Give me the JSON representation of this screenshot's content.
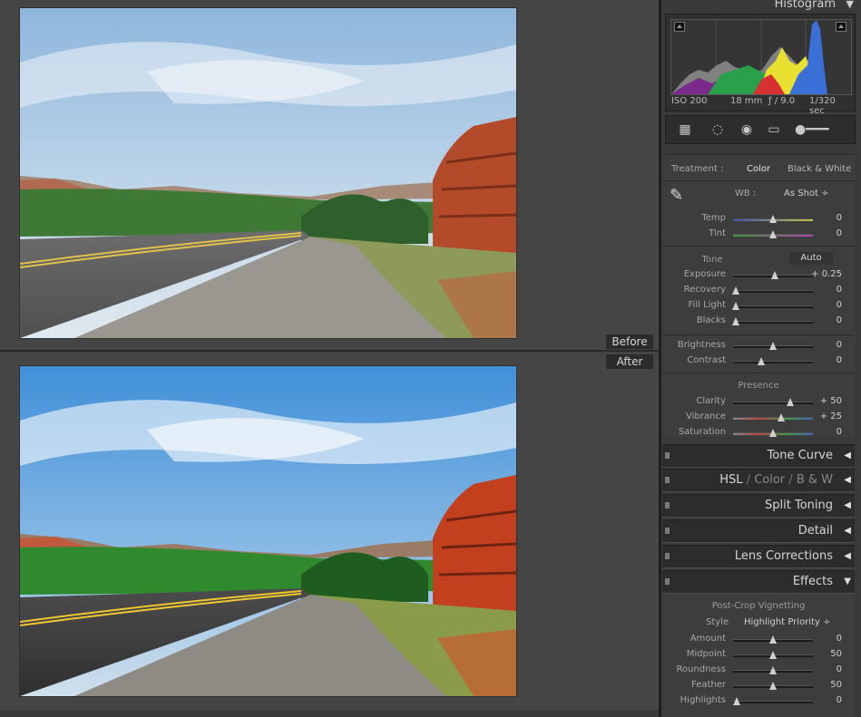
{
  "compare": {
    "before_label": "Before",
    "after_label": "After"
  },
  "histogram": {
    "title": "Histogram",
    "iso": "ISO 200",
    "focal": "18 mm",
    "aperture": "ƒ / 9.0",
    "shutter": "1/320 sec"
  },
  "basic": {
    "treatment_label": "Treatment :",
    "treatment_color": "Color",
    "treatment_bw": "Black & White",
    "wb_label": "WB :",
    "wb_value": "As Shot ÷",
    "tone_label": "Tone",
    "auto_label": "Auto",
    "presence_label": "Presence",
    "sliders": [
      {
        "label": "Temp",
        "value": "0",
        "pos": 0.5
      },
      {
        "label": "Tint",
        "value": "0",
        "pos": 0.5
      },
      {
        "label": "Exposure",
        "value": "+ 0.25",
        "pos": 0.52
      },
      {
        "label": "Recovery",
        "value": "0",
        "pos": 0.03
      },
      {
        "label": "Fill Light",
        "value": "0",
        "pos": 0.03
      },
      {
        "label": "Blacks",
        "value": "0",
        "pos": 0.03
      },
      {
        "label": "Brightness",
        "value": "0",
        "pos": 0.5
      },
      {
        "label": "Contrast",
        "value": "0",
        "pos": 0.35
      },
      {
        "label": "Clarity",
        "value": "+ 50",
        "pos": 0.72
      },
      {
        "label": "Vibrance",
        "value": "+ 25",
        "pos": 0.6
      },
      {
        "label": "Saturation",
        "value": "0",
        "pos": 0.5
      }
    ]
  },
  "panels": {
    "tone_curve": "Tone Curve",
    "hsl": "HSL",
    "color": "Color",
    "bw": "B & W",
    "split_toning": "Split Toning",
    "detail": "Detail",
    "lens_corrections": "Lens Corrections",
    "effects": "Effects"
  },
  "effects": {
    "section": "Post-Crop Vignetting",
    "style_label": "Style",
    "style_value": "Highlight Priority ÷",
    "sliders": [
      {
        "label": "Amount",
        "value": "0",
        "pos": 0.5
      },
      {
        "label": "Midpoint",
        "value": "50",
        "pos": 0.5
      },
      {
        "label": "Roundness",
        "value": "0",
        "pos": 0.5
      },
      {
        "label": "Feather",
        "value": "50",
        "pos": 0.5
      },
      {
        "label": "Highlights",
        "value": "0",
        "pos": 0.05
      }
    ]
  },
  "colors": {
    "panel_bg": "#3d3d3d",
    "header_bg": "#2c2c2c",
    "viewer_bg": "#454545"
  }
}
